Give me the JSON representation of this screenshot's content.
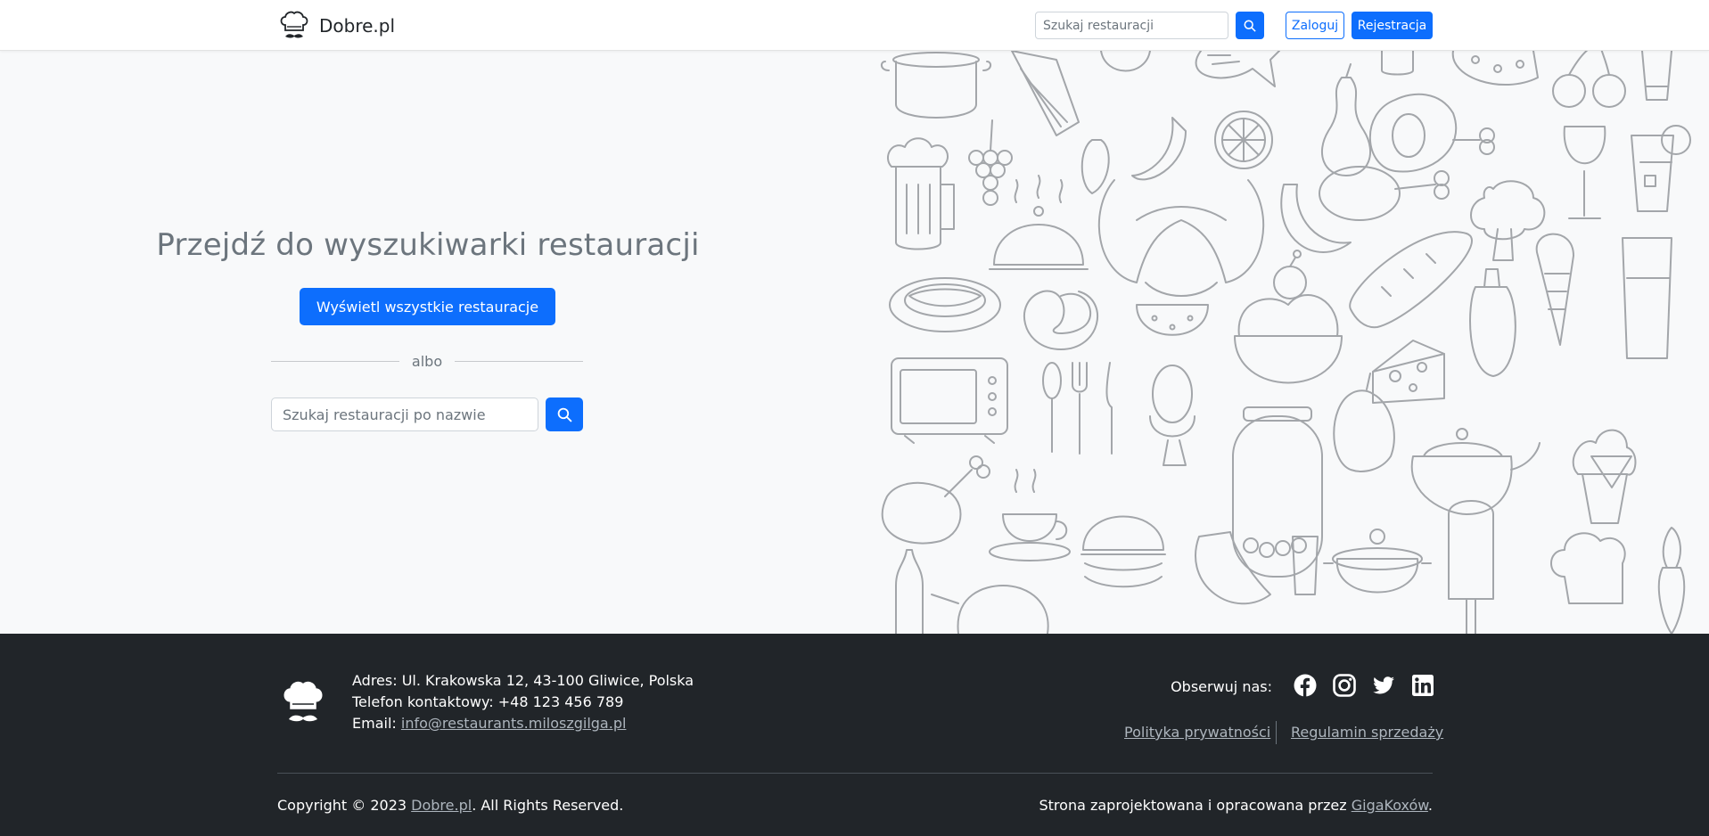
{
  "navbar": {
    "brand": "Dobre.pl",
    "search_placeholder": "Szukaj restauracji",
    "login_label": "Zaloguj",
    "register_label": "Rejestracja"
  },
  "hero": {
    "title": "Przejdź do wyszukiwarki restauracji",
    "show_all_label": "Wyświetl wszystkie restauracje",
    "divider_text": "albo",
    "search_placeholder": "Szukaj restauracji po nazwie"
  },
  "footer": {
    "address": "Adres: Ul. Krakowska 12, 43-100 Gliwice, Polska",
    "phone": "Telefon kontaktowy: +48 123 456 789",
    "email_label": "Email: ",
    "email": "info@restaurants.miloszgilga.pl",
    "follow_label": "Obserwuj nas:",
    "social": [
      "facebook-icon",
      "instagram-icon",
      "twitter-icon",
      "linkedin-icon"
    ],
    "privacy_label": "Polityka prywatności",
    "terms_label": "Regulamin sprzedaży",
    "copyright_prefix": "Copyright © 2023 ",
    "copyright_link": "Dobre.pl",
    "copyright_suffix": ". All Rights Reserved.",
    "designer_prefix": "Strona zaprojektowana i opracowana przez ",
    "designer_link": "GigaKoxów",
    "designer_suffix": "."
  },
  "colors": {
    "primary": "#0d6efd",
    "footer_bg": "#212529",
    "page_bg": "#f8f9fa",
    "doodle_stroke": "#a3a6aa"
  }
}
